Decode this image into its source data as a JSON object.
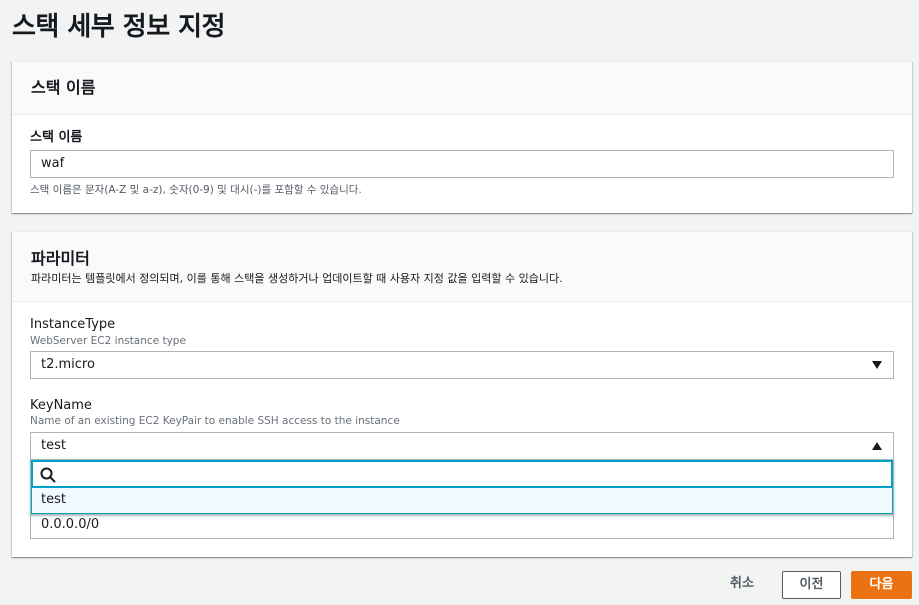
{
  "page": {
    "title": "스택 세부 정보 지정"
  },
  "stack_name_section": {
    "title": "스택 이름",
    "field_label": "스택 이름",
    "value": "waf",
    "hint": "스택 이름은 문자(A-Z 및 a-z), 숫자(0-9) 및 대시(-)를 포함할 수 있습니다."
  },
  "parameters_section": {
    "title": "파라미터",
    "description": "파라미터는 템플릿에서 정의되며, 이를 통해 스택을 생성하거나 업데이트할 때 사용자 지정 값을 입력할 수 있습니다.",
    "instance_type": {
      "label": "InstanceType",
      "description": "WebServer EC2 instance type",
      "value": "t2.micro"
    },
    "key_name": {
      "label": "KeyName",
      "description": "Name of an existing EC2 KeyPair to enable SSH access to the instance",
      "value": "test",
      "filter_value": "",
      "options": [
        "test"
      ]
    },
    "behind_field_value": "0.0.0.0/0"
  },
  "footer": {
    "cancel_label": "취소",
    "previous_label": "이전",
    "next_label": "다음"
  },
  "colors": {
    "accent": "#00a1c9",
    "primary_button": "#ec7211"
  }
}
